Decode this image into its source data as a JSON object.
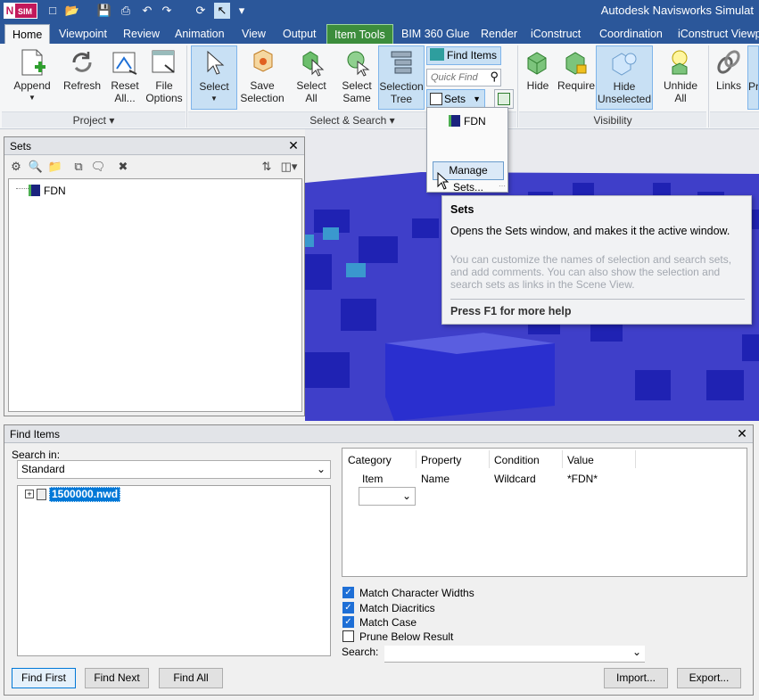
{
  "app": {
    "logo_text": "SIM",
    "title": "Autodesk Navisworks Simulat"
  },
  "ribbon_tabs": [
    {
      "label": "Home"
    },
    {
      "label": "Viewpoint"
    },
    {
      "label": "Review"
    },
    {
      "label": "Animation"
    },
    {
      "label": "View"
    },
    {
      "label": "Output"
    },
    {
      "label": "Item Tools"
    },
    {
      "label": "BIM 360 Glue"
    },
    {
      "label": "Render"
    },
    {
      "label": "iConstruct"
    },
    {
      "label": "Coordination"
    },
    {
      "label": "iConstruct Viewp"
    }
  ],
  "ribbon": {
    "project": {
      "append": "Append",
      "refresh": "Refresh",
      "reset_all": "Reset All...",
      "file_options": "File Options",
      "group_label": "Project"
    },
    "select_search": {
      "select": "Select",
      "save_selection": "Save Selection",
      "select_all": "Select All",
      "select_same": "Select Same",
      "selection_tree": "Selection Tree",
      "find_items": "Find Items",
      "quick_find_placeholder": "Quick Find",
      "sets": "Sets",
      "group_label": "Select & Search"
    },
    "visibility": {
      "hide": "Hide",
      "require": "Require",
      "hide_unselected": "Hide Unselected",
      "unhide_all": "Unhide All",
      "group_label": "Visibility"
    },
    "links": "Links",
    "partial_button": "Pr"
  },
  "sets_dropdown": {
    "items": [
      "FDN"
    ],
    "manage_button": "Manage Sets..."
  },
  "tooltip": {
    "title": "Sets",
    "description": "Opens the Sets window, and makes it the active window.",
    "detail": "You can customize the names of selection and search sets, and add comments. You can also show the selection and search sets as links in the Scene View.",
    "help": "Press F1 for more help"
  },
  "sets_panel": {
    "title": "Sets",
    "items": [
      "FDN"
    ]
  },
  "find_items": {
    "title": "Find Items",
    "search_in_label": "Search in:",
    "search_in_value": "Standard",
    "tree_item": "1500000.nwd",
    "table": {
      "headers": [
        "Category",
        "Property",
        "Condition",
        "Value"
      ],
      "rows": [
        [
          "Item",
          "Name",
          "Wildcard",
          "*FDN*"
        ]
      ]
    },
    "options": [
      {
        "label": "Match Character Widths",
        "checked": true
      },
      {
        "label": "Match Diacritics",
        "checked": true
      },
      {
        "label": "Match Case",
        "checked": true
      },
      {
        "label": "Prune Below Result",
        "checked": false
      }
    ],
    "search_label": "Search:",
    "buttons": {
      "find_first": "Find First",
      "find_next": "Find Next",
      "find_all": "Find All",
      "import": "Import...",
      "export": "Export..."
    }
  },
  "colors": {
    "title_bar": "#2b579a",
    "contextual_tab": "#3c8d3c",
    "model_blue": "#2a2fcf",
    "selection_highlight": "#0078d7"
  }
}
